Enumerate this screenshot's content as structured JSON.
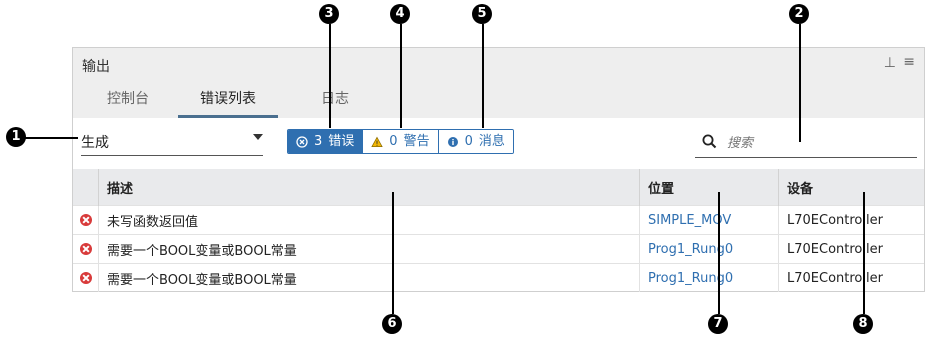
{
  "panel": {
    "title": "输出",
    "pin_icon": "pin-icon",
    "menu_icon": "hamburger-menu-icon"
  },
  "tabs": [
    {
      "label": "控制台",
      "active": false
    },
    {
      "label": "错误列表",
      "active": true
    },
    {
      "label": "日志",
      "active": false
    }
  ],
  "toolbar": {
    "filter_value": "生成",
    "segments": [
      {
        "count": "3",
        "label": "错误",
        "icon": "error-circle-icon",
        "active": true
      },
      {
        "count": "0",
        "label": "警告",
        "icon": "warning-triangle-icon",
        "active": false
      },
      {
        "count": "0",
        "label": "消息",
        "icon": "info-circle-icon",
        "active": false
      }
    ],
    "search_placeholder": "搜索",
    "search_icon": "magnifier-icon"
  },
  "table": {
    "columns": [
      "描述",
      "位置",
      "设备"
    ],
    "rows": [
      {
        "description": "未写函数返回值",
        "location": "SIMPLE_MOV",
        "device": "L70EController"
      },
      {
        "description": "需要一个BOOL变量或BOOL常量",
        "location": "Prog1_Rung0",
        "device": "L70EController"
      },
      {
        "description": "需要一个BOOL变量或BOOL常量",
        "location": "Prog1_Rung0",
        "device": "L70EController"
      }
    ]
  },
  "callouts": [
    "1",
    "2",
    "3",
    "4",
    "5",
    "6",
    "7",
    "8"
  ],
  "colors": {
    "accent": "#2f6fb0",
    "error": "#d83a3a",
    "header_bg": "#eeeeee",
    "tab_underline": "#4a6f8f"
  }
}
